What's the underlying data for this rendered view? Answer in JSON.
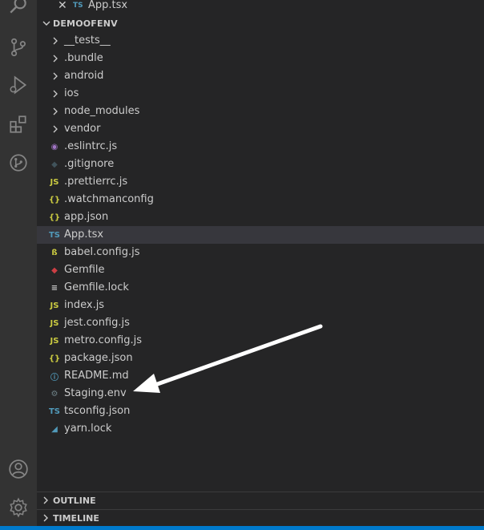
{
  "open_editor": {
    "close_glyph": "✕",
    "type_badge": "TS",
    "file": "App.tsx"
  },
  "explorer": {
    "title": "DEMOOFENV",
    "folders": [
      {
        "label": "__tests__"
      },
      {
        "label": ".bundle"
      },
      {
        "label": "android"
      },
      {
        "label": "ios"
      },
      {
        "label": "node_modules"
      },
      {
        "label": "vendor"
      }
    ],
    "files": [
      {
        "label": ".eslintrc.js",
        "icon": "eslint-icon",
        "badge": "◉",
        "color": "#a074c4"
      },
      {
        "label": ".gitignore",
        "icon": "git-icon",
        "badge": "◆",
        "color": "#41535b"
      },
      {
        "label": ".prettierrc.js",
        "icon": "js-icon",
        "badge": "JS",
        "color": "#cbcb41"
      },
      {
        "label": ".watchmanconfig",
        "icon": "json-icon",
        "badge": "{}",
        "color": "#cbcb41"
      },
      {
        "label": "app.json",
        "icon": "json-icon",
        "badge": "{}",
        "color": "#cbcb41"
      },
      {
        "label": "App.tsx",
        "icon": "ts-icon",
        "badge": "TS",
        "color": "#519aba",
        "selected": true
      },
      {
        "label": "babel.config.js",
        "icon": "babel-icon",
        "badge": "ß",
        "color": "#cbcb41"
      },
      {
        "label": "Gemfile",
        "icon": "ruby-icon",
        "badge": "◆",
        "color": "#cc3e44"
      },
      {
        "label": "Gemfile.lock",
        "icon": "lines-icon",
        "badge": "≡",
        "color": "#cccccc"
      },
      {
        "label": "index.js",
        "icon": "js-icon",
        "badge": "JS",
        "color": "#cbcb41"
      },
      {
        "label": "jest.config.js",
        "icon": "js-icon",
        "badge": "JS",
        "color": "#cbcb41"
      },
      {
        "label": "metro.config.js",
        "icon": "js-icon",
        "badge": "JS",
        "color": "#cbcb41"
      },
      {
        "label": "package.json",
        "icon": "json-icon",
        "badge": "{}",
        "color": "#cbcb41"
      },
      {
        "label": "README.md",
        "icon": "info-icon",
        "badge": "ⓘ",
        "color": "#519aba"
      },
      {
        "label": "Staging.env",
        "icon": "gear-icon",
        "badge": "⚙",
        "color": "#6d8086"
      },
      {
        "label": "tsconfig.json",
        "icon": "tsconfig-icon",
        "badge": "TS",
        "color": "#519aba"
      },
      {
        "label": "yarn.lock",
        "icon": "yarn-icon",
        "badge": "◢",
        "color": "#519aba"
      }
    ]
  },
  "bottom_sections": [
    {
      "title": "OUTLINE"
    },
    {
      "title": "TIMELINE"
    }
  ],
  "activity_icons": [
    "search-icon",
    "source-control-icon",
    "run-debug-icon",
    "extensions-icon",
    "remote-icon",
    "account-icon",
    "settings-gear-icon"
  ],
  "colors": {
    "accent": "#007acc",
    "selection": "#37373d",
    "annotation_arrow": "#ffffff"
  }
}
